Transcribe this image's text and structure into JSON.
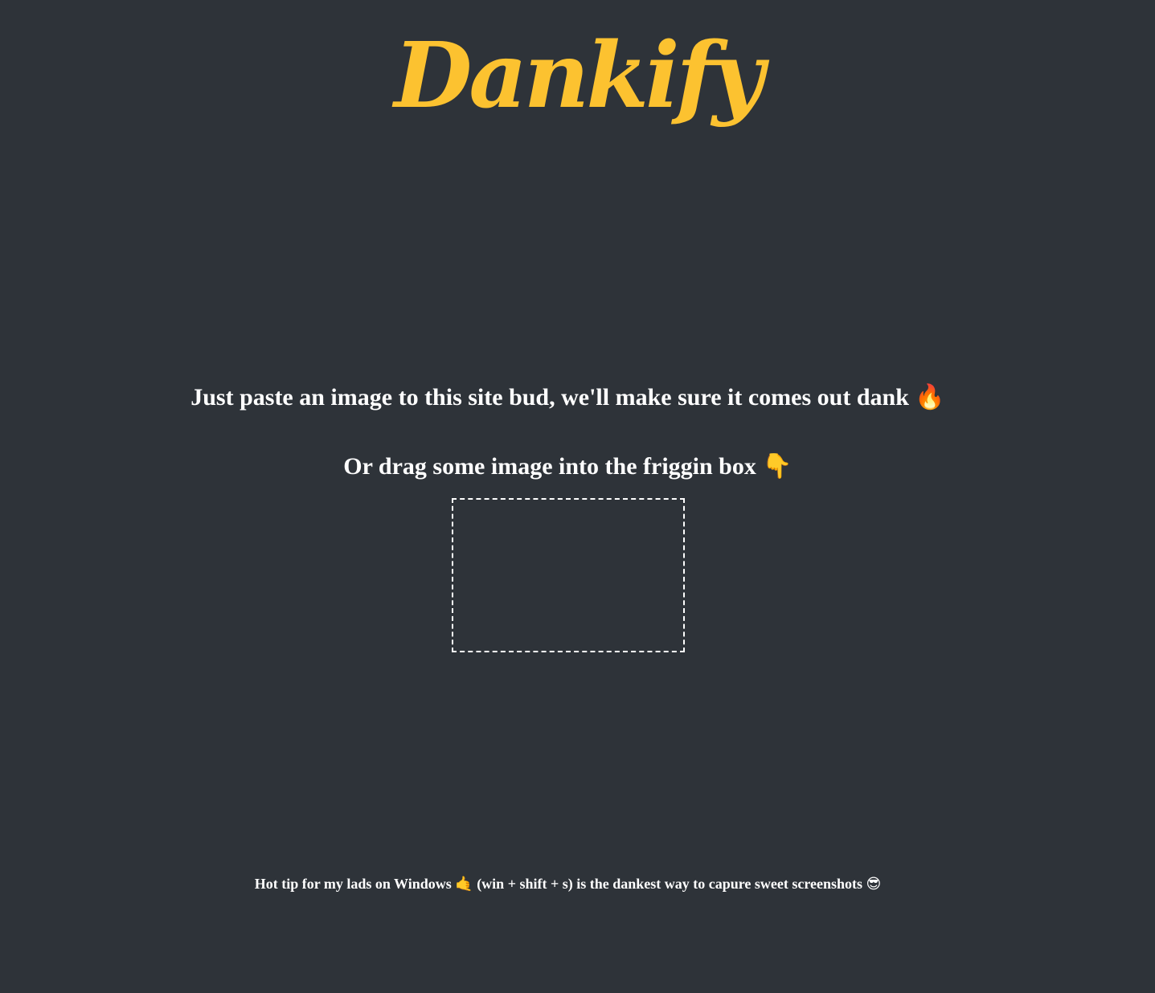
{
  "logo": {
    "text": "Dankify",
    "color": "#fcc230"
  },
  "instructions": {
    "paste_text": "Just paste an image to this site bud, we'll make sure it comes out dank",
    "paste_emoji": "🔥",
    "drag_text": "Or drag some image into the friggin box",
    "drag_emoji": "👇"
  },
  "drop_zone": {
    "label": ""
  },
  "tip": {
    "prefix": "Hot tip for my lads on Windows",
    "emoji_hand": "🤙",
    "suffix": "(win + shift + s) is the dankest way to capure sweet screenshots",
    "emoji_face": "😎"
  },
  "colors": {
    "background": "#2e3339",
    "accent": "#fcc230",
    "text": "#ffffff"
  }
}
